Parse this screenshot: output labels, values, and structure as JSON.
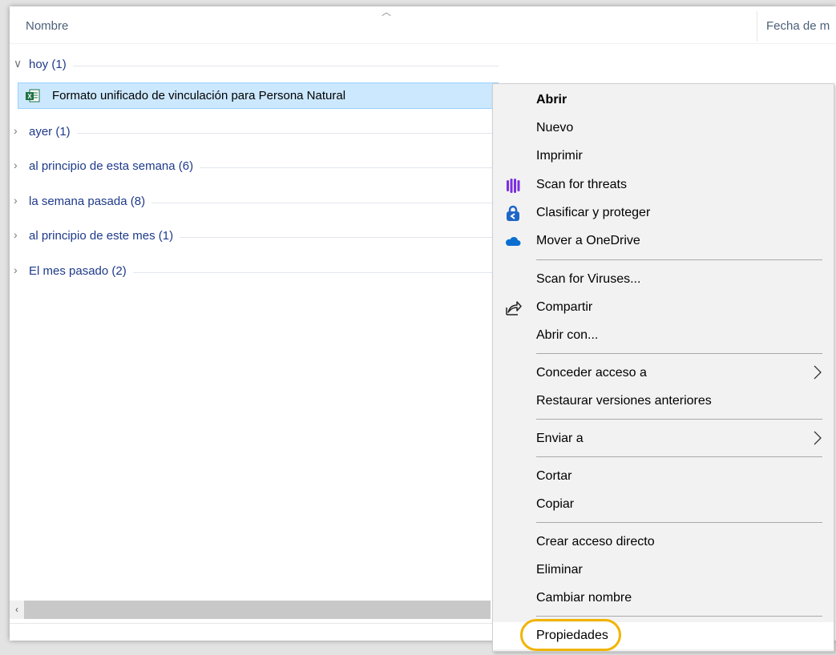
{
  "columns": {
    "name": "Nombre",
    "date": "Fecha de m"
  },
  "groups": [
    {
      "label": "hoy (1)",
      "expanded": true
    },
    {
      "label": "ayer (1)",
      "expanded": false
    },
    {
      "label": "al principio de esta semana (6)",
      "expanded": false
    },
    {
      "label": "la semana pasada (8)",
      "expanded": false
    },
    {
      "label": "al principio de este mes (1)",
      "expanded": false
    },
    {
      "label": "El mes pasado (2)",
      "expanded": false
    }
  ],
  "selected_file": {
    "name": "Formato unificado de vinculación para Persona Natural",
    "icon": "excel-file-icon"
  },
  "context_menu": {
    "items": [
      {
        "label": "Abrir",
        "bold": true
      },
      {
        "label": "Nuevo"
      },
      {
        "label": "Imprimir"
      },
      {
        "label": "Scan for threats",
        "icon": "shield-bars-icon"
      },
      {
        "label": "Clasificar y proteger",
        "icon": "lock-label-icon"
      },
      {
        "label": "Mover a OneDrive",
        "icon": "onedrive-cloud-icon"
      },
      {
        "label": "Scan for Viruses..."
      },
      {
        "label": "Compartir",
        "icon": "share-icon"
      },
      {
        "label": "Abrir con..."
      },
      {
        "label": "Conceder acceso a",
        "submenu": true
      },
      {
        "label": "Restaurar versiones anteriores"
      },
      {
        "label": "Enviar a",
        "submenu": true
      },
      {
        "label": "Cortar"
      },
      {
        "label": "Copiar"
      },
      {
        "label": "Crear acceso directo"
      },
      {
        "label": "Eliminar"
      },
      {
        "label": "Cambiar nombre"
      },
      {
        "label": "Propiedades",
        "highlighted": true
      }
    ]
  },
  "colors": {
    "selection": "#cce8ff",
    "group_text": "#1e3a8a",
    "highlight_ring": "#f2b400",
    "menu_bg": "#f2f2f2"
  }
}
